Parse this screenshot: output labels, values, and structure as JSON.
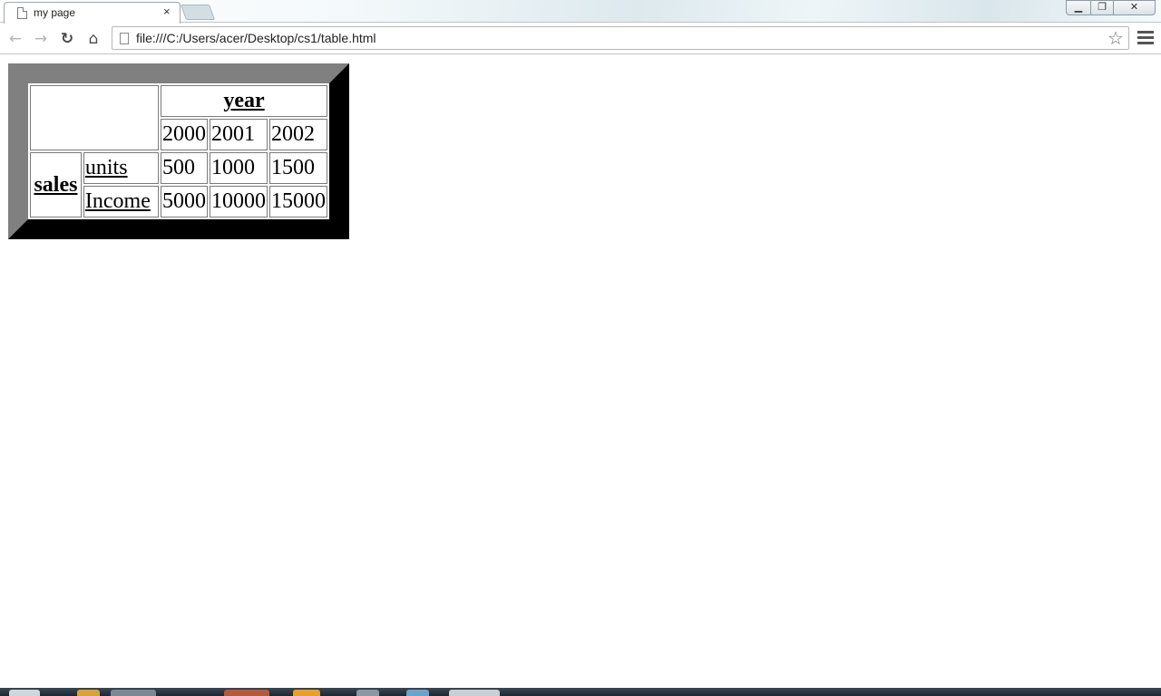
{
  "browser": {
    "tab_title": "my page",
    "tab_close": "×",
    "url": "file:///C:/Users/acer/Desktop/cs1/table.html",
    "icons": [
      "page-icon",
      "back-arrow-icon",
      "forward-arrow-icon",
      "reload-icon",
      "home-icon",
      "bookmark-star-icon",
      "menu-icon",
      "close-icon"
    ]
  },
  "table": {
    "header": "year",
    "years": [
      "2000",
      "2001",
      "2002"
    ],
    "row_group": "sales",
    "rows": [
      {
        "label": "units",
        "values": [
          "500",
          "1000",
          "1500"
        ]
      },
      {
        "label": "Income",
        "values": [
          "5000",
          "10000",
          "15000"
        ]
      }
    ]
  },
  "colors": {
    "table_border_light": "#808080",
    "table_border_dark": "#2e2e2e"
  }
}
